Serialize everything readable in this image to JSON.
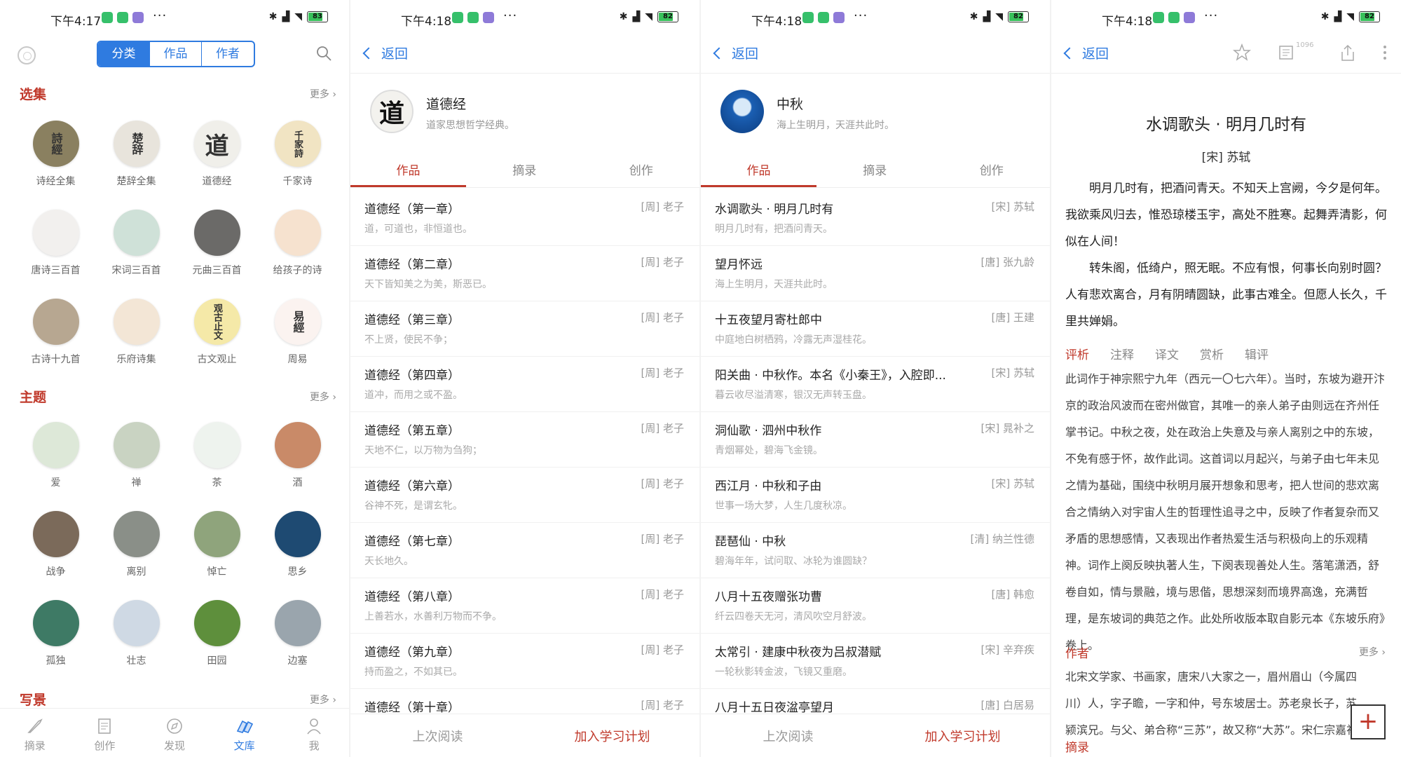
{
  "panel1": {
    "status": {
      "time": "下午4:17",
      "battery": "83"
    },
    "segments": [
      "分类",
      "作品",
      "作者"
    ],
    "active_segment": "分类",
    "sections": [
      {
        "title": "选集",
        "more": "更多 ›",
        "items": [
          {
            "label": "诗经全集",
            "glyph": "詩經",
            "bg": "#8a8060"
          },
          {
            "label": "楚辞全集",
            "glyph": "楚辞",
            "bg": "#e8e4dc"
          },
          {
            "label": "道德经",
            "glyph": "道",
            "bg": "#f0efea"
          },
          {
            "label": "千家诗",
            "glyph": "千家詩",
            "bg": "#f1e4c3"
          },
          {
            "label": "唐诗三百首",
            "glyph": "",
            "bg": "#f2f0ee"
          },
          {
            "label": "宋词三百首",
            "glyph": "",
            "bg": "#cfe1d8"
          },
          {
            "label": "元曲三百首",
            "glyph": "",
            "bg": "#6b6a68"
          },
          {
            "label": "给孩子的诗",
            "glyph": "",
            "bg": "#f6e2cf"
          },
          {
            "label": "古诗十九首",
            "glyph": "",
            "bg": "#b7a791"
          },
          {
            "label": "乐府诗集",
            "glyph": "",
            "bg": "#f3e6d6"
          },
          {
            "label": "古文观止",
            "glyph": "观古止文",
            "bg": "#f5e9a8"
          },
          {
            "label": "周易",
            "glyph": "易經",
            "bg": "#fbf3f0"
          }
        ]
      },
      {
        "title": "主题",
        "more": "更多 ›",
        "items": [
          {
            "label": "爱",
            "glyph": "",
            "bg": "#dde8d8"
          },
          {
            "label": "禅",
            "glyph": "",
            "bg": "#c9d3c2"
          },
          {
            "label": "茶",
            "glyph": "",
            "bg": "#eef3ee"
          },
          {
            "label": "酒",
            "glyph": "",
            "bg": "#c98a68"
          },
          {
            "label": "战争",
            "glyph": "",
            "bg": "#7b6a5a"
          },
          {
            "label": "离别",
            "glyph": "",
            "bg": "#8a8f88"
          },
          {
            "label": "悼亡",
            "glyph": "",
            "bg": "#8fa47c"
          },
          {
            "label": "思乡",
            "glyph": "",
            "bg": "#1e4a72"
          },
          {
            "label": "孤独",
            "glyph": "",
            "bg": "#3e7a65"
          },
          {
            "label": "壮志",
            "glyph": "",
            "bg": "#cfd9e4"
          },
          {
            "label": "田园",
            "glyph": "",
            "bg": "#5e8f3c"
          },
          {
            "label": "边塞",
            "glyph": "",
            "bg": "#9aa5ad"
          }
        ]
      },
      {
        "title": "写景",
        "more": "更多 ›",
        "items": []
      }
    ],
    "tabbar": [
      "摘录",
      "创作",
      "发现",
      "文库",
      "我"
    ],
    "active_tab": "文库"
  },
  "panel2": {
    "status": {
      "time": "下午4:18",
      "battery": "82"
    },
    "back": "返回",
    "collection": {
      "glyph": "道",
      "title": "道德经",
      "subtitle": "道家思想哲学经典。"
    },
    "tabs": [
      "作品",
      "摘录",
      "创作"
    ],
    "rows": [
      {
        "title": "道德经（第一章）",
        "author": "[周] 老子",
        "snippet": "道，可道也，非恒道也。"
      },
      {
        "title": "道德经（第二章）",
        "author": "[周] 老子",
        "snippet": "天下皆知美之为美，斯恶已。"
      },
      {
        "title": "道德经（第三章）",
        "author": "[周] 老子",
        "snippet": "不上贤，使民不争；"
      },
      {
        "title": "道德经（第四章）",
        "author": "[周] 老子",
        "snippet": "道冲，而用之或不盈。"
      },
      {
        "title": "道德经（第五章）",
        "author": "[周] 老子",
        "snippet": "天地不仁，以万物为刍狗；"
      },
      {
        "title": "道德经（第六章）",
        "author": "[周] 老子",
        "snippet": "谷神不死，是谓玄牝。"
      },
      {
        "title": "道德经（第七章）",
        "author": "[周] 老子",
        "snippet": "天长地久。"
      },
      {
        "title": "道德经（第八章）",
        "author": "[周] 老子",
        "snippet": "上善若水，水善利万物而不争。"
      },
      {
        "title": "道德经（第九章）",
        "author": "[周] 老子",
        "snippet": "持而盈之，不如其已。"
      },
      {
        "title": "道德经（第十章）",
        "author": "[周] 老子",
        "snippet": ""
      }
    ],
    "bottom": {
      "last_read": "上次阅读",
      "add_plan": "加入学习计划"
    }
  },
  "panel3": {
    "status": {
      "time": "下午4:18",
      "battery": "82"
    },
    "back": "返回",
    "collection": {
      "title": "中秋",
      "subtitle": "海上生明月，天涯共此时。"
    },
    "tabs": [
      "作品",
      "摘录",
      "创作"
    ],
    "rows": [
      {
        "title": "水调歌头 · 明月几时有",
        "author": "[宋] 苏轼",
        "snippet": "明月几时有，把酒问青天。"
      },
      {
        "title": "望月怀远",
        "author": "[唐] 张九龄",
        "snippet": "海上生明月，天涯共此时。"
      },
      {
        "title": "十五夜望月寄杜郎中",
        "author": "[唐] 王建",
        "snippet": "中庭地白树栖鸦，冷露无声湿桂花。"
      },
      {
        "title": "阳关曲 · 中秋作。本名《小秦王》，入腔即...",
        "author": "[宋] 苏轼",
        "snippet": "暮云收尽溢清寒，银汉无声转玉盘。"
      },
      {
        "title": "洞仙歌 · 泗州中秋作",
        "author": "[宋] 晁补之",
        "snippet": "青烟幂处，碧海飞金镜。"
      },
      {
        "title": "西江月 · 中秋和子由",
        "author": "[宋] 苏轼",
        "snippet": "世事一场大梦，人生几度秋凉。"
      },
      {
        "title": "琵琶仙 · 中秋",
        "author": "[清] 纳兰性德",
        "snippet": "碧海年年，试问取、冰轮为谁圆缺？"
      },
      {
        "title": "八月十五夜赠张功曹",
        "author": "[唐] 韩愈",
        "snippet": "纤云四卷天无河，清风吹空月舒波。"
      },
      {
        "title": "太常引 · 建康中秋夜为吕叔潜赋",
        "author": "[宋] 辛弃疾",
        "snippet": "一轮秋影转金波，飞镜又重磨。"
      },
      {
        "title": "八月十五日夜湓亭望月",
        "author": "[唐] 白居易",
        "snippet": ""
      }
    ],
    "bottom": {
      "last_read": "上次阅读",
      "add_plan": "加入学习计划"
    }
  },
  "panel4": {
    "status": {
      "time": "下午4:18",
      "battery": "82"
    },
    "back": "返回",
    "count_badge": "1096",
    "title": "水调歌头 · 明月几时有",
    "author": "[宋] 苏轼",
    "body": [
      "明月几时有，把酒问青天。不知天上宫阙，今夕是何年。我欲乘风归去，惟恐琼楼玉宇，高处不胜寒。起舞弄清影，何似在人间！",
      "转朱阁，低绮户，照无眠。不应有恨，何事长向别时圆？人有悲欢离合，月有阴晴圆缺，此事古难全。但愿人长久，千里共婵娟。"
    ],
    "tabs": [
      "评析",
      "注释",
      "译文",
      "赏析",
      "辑评"
    ],
    "commentary": "此词作于神宗熙宁九年（西元一〇七六年）。当时，东坡为避开汴京的政治风波而在密州做官，其唯一的亲人弟子由则远在齐州任掌书记。中秋之夜，处在政治上失意及与亲人离别之中的东坡，不免有感于怀，故作此词。这首词以月起兴，与弟子由七年未见之情为基础，围绕中秋明月展开想象和思考，把人世间的悲欢离合之情纳入对宇宙人生的哲理性追寻之中，反映了作者复杂而又矛盾的思想感情，又表现出作者热爱生活与积极向上的乐观精神。词作上阕反映执著人生，下阕表现善处人生。落笔潇洒，舒卷自如，情与景融，境与思偕，思想深刻而境界高逸，充满哲理，是东坡词的典范之作。此处所收版本取自影元本《东坡乐府》卷上。",
    "author_section": {
      "title": "作者",
      "more": "更多 ›",
      "bio": "北宋文学家、书画家，唐宋八大家之一，眉州眉山（今属四川）人，字子瞻，一字和仲，号东坡居士。苏老泉长子，苏颍滨兄。与父、弟合称“三苏”，故又称“大苏”。宋仁宗嘉祐"
    },
    "excerpt_title": "摘录",
    "fab": "+"
  }
}
